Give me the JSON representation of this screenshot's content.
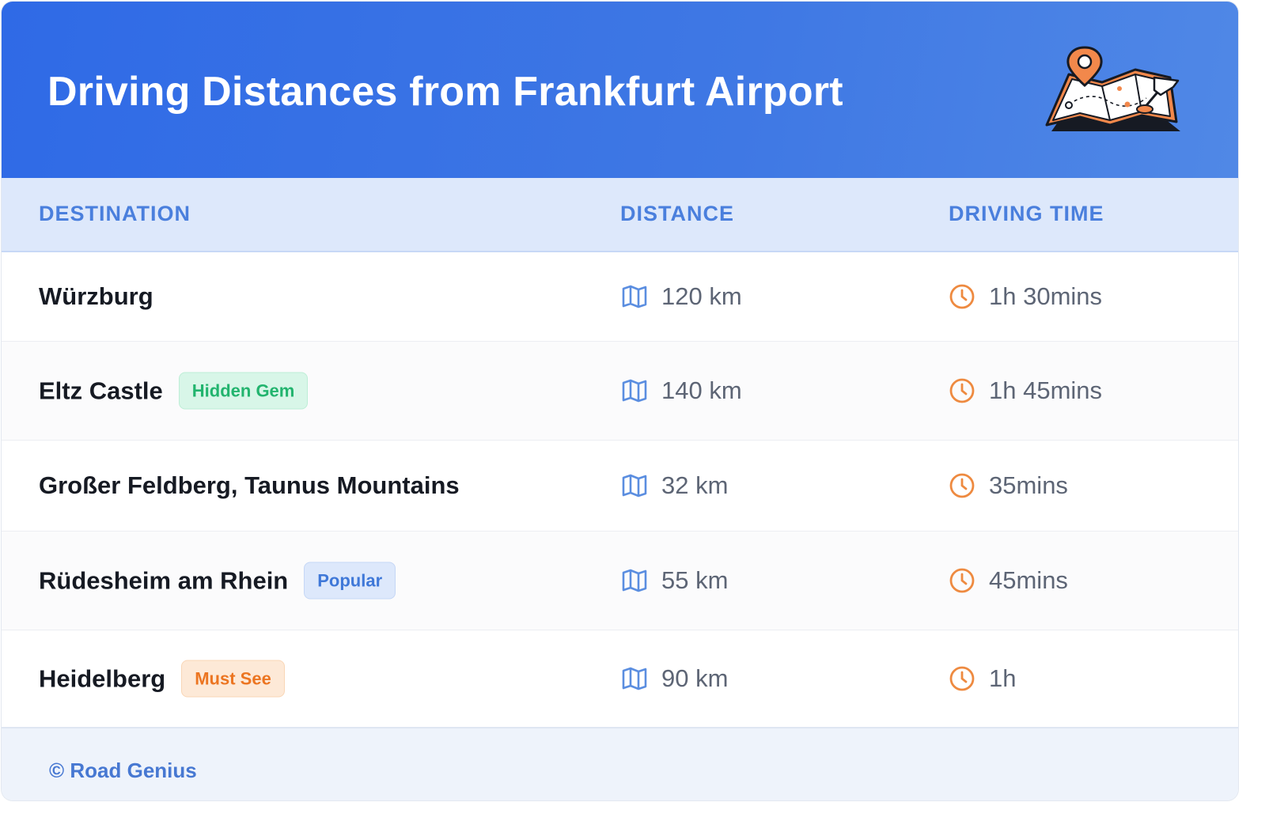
{
  "title": "Driving Distances from Frankfurt Airport",
  "columns": {
    "destination": "DESTINATION",
    "distance": "DISTANCE",
    "driving_time": "DRIVING TIME"
  },
  "rows": [
    {
      "destination": "Würzburg",
      "badge": "",
      "distance": "120 km",
      "time": "1h 30mins"
    },
    {
      "destination": "Eltz Castle",
      "badge": "Hidden Gem",
      "distance": "140 km",
      "time": "1h 45mins"
    },
    {
      "destination": "Großer Feldberg, Taunus Mountains",
      "badge": "",
      "distance": "32 km",
      "time": "35mins"
    },
    {
      "destination": "Rüdesheim am Rhein",
      "badge": "Popular",
      "distance": "55 km",
      "time": "45mins"
    },
    {
      "destination": "Heidelberg",
      "badge": "Must See",
      "distance": "90 km",
      "time": "1h"
    }
  ],
  "footer": {
    "credit": "© Road Genius"
  },
  "icons": {
    "distance": "map-icon",
    "time": "clock-icon",
    "header": "folded-map-with-pins-illustration"
  },
  "colors": {
    "header_start": "#2f6ae6",
    "header_end": "#5088e6",
    "accent_blue": "#4a7fdd",
    "clock_orange": "#ee8a40",
    "badge_green": "#22b46e",
    "badge_blue": "#3f78d8",
    "badge_orange": "#ec7521"
  }
}
